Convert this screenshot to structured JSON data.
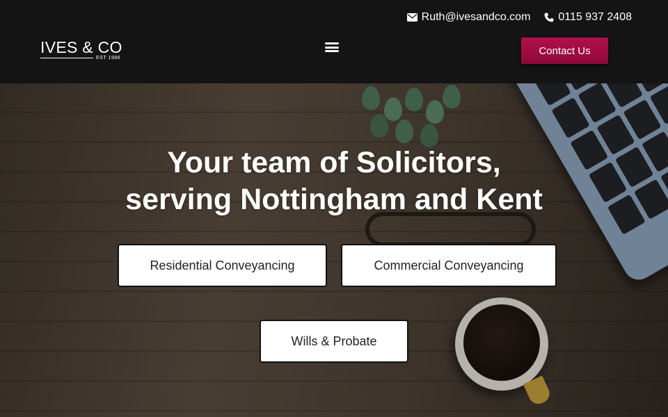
{
  "header": {
    "email": "Ruth@ivesandco.com",
    "phone": "0115 937 2408",
    "logo": {
      "name": "IVES & CO",
      "tagline": "EST 1986"
    },
    "menu_icon": "hamburger-menu-icon",
    "contact_button": "Contact Us",
    "colors": {
      "background": "#141414",
      "accent": "#a30d44"
    }
  },
  "hero": {
    "title_line1": "Your team of Solicitors,",
    "title_line2": "serving Nottingham and Kent",
    "services": [
      {
        "label": "Residential Conveyancing"
      },
      {
        "label": "Commercial Conveyancing"
      },
      {
        "label": "Wills & Probate"
      }
    ]
  },
  "icons": {
    "email": "envelope-icon",
    "phone": "phone-icon"
  }
}
